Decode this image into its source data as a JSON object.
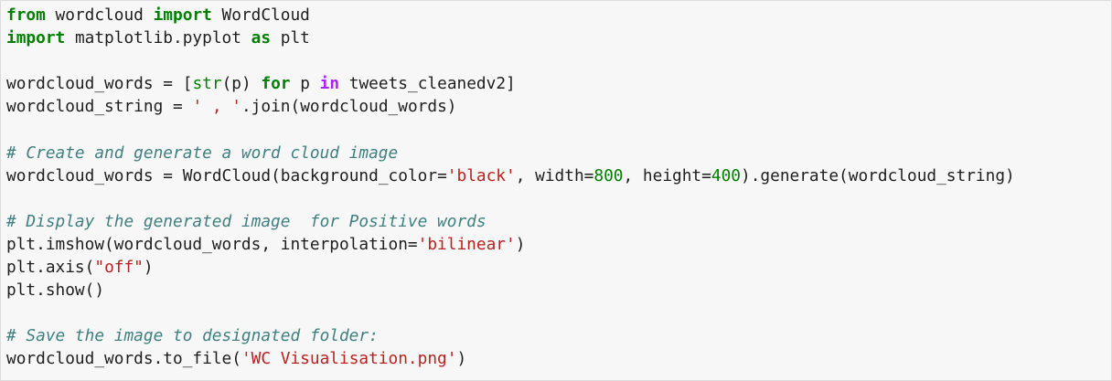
{
  "cell": {
    "lines": [
      [
        {
          "t": "from",
          "k": "kw"
        },
        {
          "t": " wordcloud ",
          "k": "plain"
        },
        {
          "t": "import",
          "k": "kw"
        },
        {
          "t": " WordCloud",
          "k": "plain"
        }
      ],
      [
        {
          "t": "import",
          "k": "kw"
        },
        {
          "t": " matplotlib.pyplot ",
          "k": "plain"
        },
        {
          "t": "as",
          "k": "kw"
        },
        {
          "t": " plt",
          "k": "plain"
        }
      ],
      [],
      [
        {
          "t": "wordcloud_words ",
          "k": "plain"
        },
        {
          "t": "=",
          "k": "plain"
        },
        {
          "t": " [",
          "k": "plain"
        },
        {
          "t": "str",
          "k": "bi"
        },
        {
          "t": "(p) ",
          "k": "plain"
        },
        {
          "t": "for",
          "k": "kw"
        },
        {
          "t": " p ",
          "k": "plain"
        },
        {
          "t": "in",
          "k": "op"
        },
        {
          "t": " tweets_cleanedv2]",
          "k": "plain"
        }
      ],
      [
        {
          "t": "wordcloud_string ",
          "k": "plain"
        },
        {
          "t": "=",
          "k": "plain"
        },
        {
          "t": " ",
          "k": "plain"
        },
        {
          "t": "' , '",
          "k": "str"
        },
        {
          "t": ".join(wordcloud_words)",
          "k": "plain"
        }
      ],
      [],
      [
        {
          "t": "# Create and generate a word cloud image",
          "k": "cmt"
        }
      ],
      [
        {
          "t": "wordcloud_words ",
          "k": "plain"
        },
        {
          "t": "=",
          "k": "plain"
        },
        {
          "t": " WordCloud(background_color",
          "k": "plain"
        },
        {
          "t": "=",
          "k": "plain"
        },
        {
          "t": "'black'",
          "k": "str"
        },
        {
          "t": ", width",
          "k": "plain"
        },
        {
          "t": "=",
          "k": "plain"
        },
        {
          "t": "800",
          "k": "num"
        },
        {
          "t": ", height",
          "k": "plain"
        },
        {
          "t": "=",
          "k": "plain"
        },
        {
          "t": "400",
          "k": "num"
        },
        {
          "t": ").generate(wordcloud_string)",
          "k": "plain"
        }
      ],
      [],
      [
        {
          "t": "# Display the generated image  for Positive words",
          "k": "cmt"
        }
      ],
      [
        {
          "t": "plt.imshow(wordcloud_words, interpolation",
          "k": "plain"
        },
        {
          "t": "=",
          "k": "plain"
        },
        {
          "t": "'bilinear'",
          "k": "str"
        },
        {
          "t": ")",
          "k": "plain"
        }
      ],
      [
        {
          "t": "plt.axis(",
          "k": "plain"
        },
        {
          "t": "\"off\"",
          "k": "str"
        },
        {
          "t": ")",
          "k": "plain"
        }
      ],
      [
        {
          "t": "plt.show()",
          "k": "plain"
        }
      ],
      [],
      [
        {
          "t": "# Save the image to designated folder:",
          "k": "cmt"
        }
      ],
      [
        {
          "t": "wordcloud_words.to_file(",
          "k": "plain"
        },
        {
          "t": "'WC Visualisation.png'",
          "k": "str"
        },
        {
          "t": ")",
          "k": "plain"
        }
      ]
    ]
  }
}
